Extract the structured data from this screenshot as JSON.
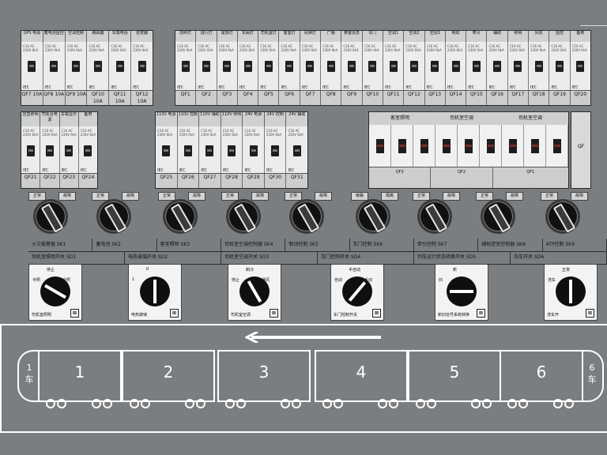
{
  "upper_left_breakers": {
    "labels": [
      "UPS 电源",
      "蓄电池监控",
      "空调控制",
      "路由器",
      "车载电话",
      "逆变器"
    ],
    "spec": "C16 AC 230V 6kA",
    "iec": "IEC",
    "ratings": [
      "QF7 10A",
      "QF8 10A",
      "QF9 10A",
      "QF10 10A",
      "QF11 10A",
      "QF12 10A"
    ]
  },
  "upper_right_breakers": {
    "labels": [
      "前照灯",
      "运行灯",
      "尾部灯",
      "车厢灯",
      "司机室灯",
      "客室灯",
      "阅读灯",
      "广播",
      "乘客信息",
      "车门",
      "空调1",
      "空调2",
      "空调3",
      "制动",
      "牵引",
      "辅助",
      "照明",
      "风机",
      "监控",
      "备用"
    ],
    "spec": "C16 AC 230V 6kA",
    "iec": "IEC",
    "ratings": [
      "QF1",
      "QF2",
      "QF3",
      "QF4",
      "QF5",
      "QF6",
      "QF7",
      "QF8",
      "QF9",
      "QF10",
      "QF11",
      "QF12",
      "QF13",
      "QF14",
      "QF15",
      "QF16",
      "QF17",
      "QF18",
      "QF19",
      "QF20"
    ]
  },
  "mid_left_breakers": {
    "labels": [
      "应急照明",
      "司机台电源",
      "车载显示",
      "备用"
    ],
    "spec": "C16 AC 230V 6kA",
    "iec": "IEC",
    "ratings": [
      "QF21",
      "QF22",
      "QF23",
      "QF24"
    ]
  },
  "mid_center_breakers": {
    "labels": [
      "110V 电源",
      "110V 控制",
      "110V 辅助",
      "110V 照明",
      "24V 电源",
      "24V 控制",
      "24V 辅助"
    ],
    "spec": "C16 AC 230V 6kA",
    "iec": "IEC",
    "ratings": [
      "QF25",
      "QF26",
      "QF27",
      "QF28",
      "QF29",
      "QF30",
      "QF31"
    ]
  },
  "rcd_group": {
    "heads": [
      "客室照明",
      "司机室空调",
      "司机室空调"
    ],
    "feet": [
      "QF3",
      "QF2",
      "QF1"
    ]
  },
  "small_box": {
    "label": "QF"
  },
  "rotary_row": {
    "labels": [
      "正常",
      "故障",
      "正常",
      "故障",
      "正常",
      "故障",
      "正常",
      "故障",
      "正常",
      "故障",
      "旁路",
      "隔离",
      "正常",
      "故障",
      "正常",
      "故障",
      "正常",
      "故障"
    ],
    "knob_count": 9
  },
  "desc_rows": {
    "row1": [
      "火灾报警器 SK1",
      "蓄电池 SK2",
      "客室照明 SK3",
      "司机室空调控制器 SK4",
      "制动控制 SK5",
      "车门控制 SK6",
      "牵引控制 SK7",
      "辅助逆变控制器 SK8",
      "ATP控制 SK9"
    ],
    "row2": [
      "司机室照明开关 SD1",
      "电热玻璃开关 SD2",
      "司机室空调开关 SD3",
      "车门控制开关 SD4",
      "列车运行状态转换开关 SD5",
      "洗车开关 SD6"
    ]
  },
  "switches": [
    {
      "caps": [
        "停止",
        "半照",
        "全照"
      ],
      "name": "司机室照明"
    },
    {
      "caps": [
        "0",
        "1"
      ],
      "name": "电热玻璃"
    },
    {
      "caps": [
        "制冷",
        "停止",
        "通风"
      ],
      "name": "司机室空调"
    },
    {
      "caps": [
        "半自动",
        "自动",
        "手动"
      ],
      "name": "车门控制开关"
    },
    {
      "caps": [
        "新",
        "旧"
      ],
      "name": "新旧信号系统转换"
    },
    {
      "caps": [
        "正常",
        "洗车"
      ],
      "name": "洗车开"
    }
  ],
  "train": {
    "cars": [
      "1",
      "2",
      "3",
      "4",
      "5",
      "6"
    ],
    "left_end": [
      "1",
      "车"
    ],
    "right_end": [
      "6",
      "车"
    ]
  },
  "colors": {
    "background": "#7b7e80",
    "train_outline": "#ffffff",
    "breaker_handle": "#1e1e1e"
  }
}
